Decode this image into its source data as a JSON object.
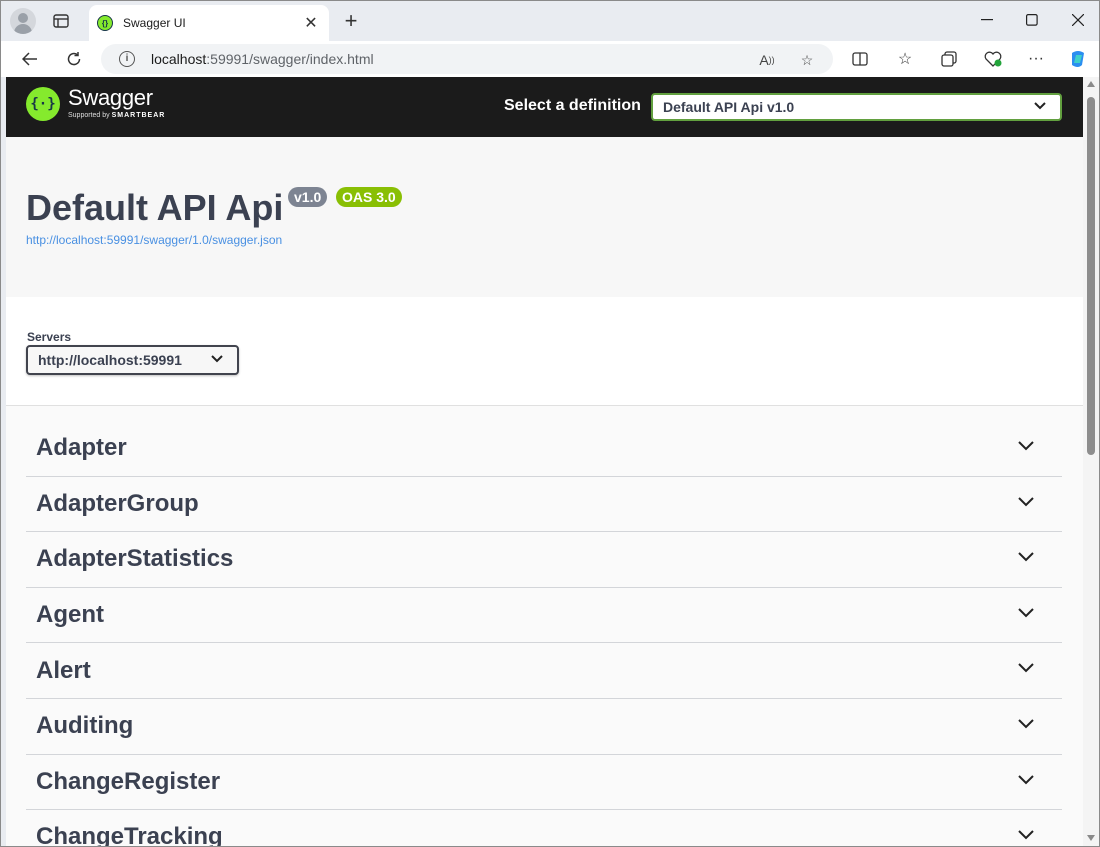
{
  "browser": {
    "tab_title": "Swagger UI",
    "url_host": "localhost",
    "url_rest": ":59991/swagger/index.html"
  },
  "swagger": {
    "logo_text": "Swagger",
    "logo_tagline_prefix": "Supported by",
    "logo_tagline_brand": "SMARTBEAR",
    "select_definition_label": "Select a definition",
    "definition_selected": "Default API Api v1.0",
    "api_title": "Default API Api",
    "version_badge": "v1.0",
    "oas_badge": "OAS 3.0",
    "spec_url": "http://localhost:59991/swagger/1.0/swagger.json",
    "servers_label": "Servers",
    "server_selected": "http://localhost:59991",
    "tags": [
      {
        "name": "Adapter"
      },
      {
        "name": "AdapterGroup"
      },
      {
        "name": "AdapterStatistics"
      },
      {
        "name": "Agent"
      },
      {
        "name": "Alert"
      },
      {
        "name": "Auditing"
      },
      {
        "name": "ChangeRegister"
      },
      {
        "name": "ChangeTracking"
      }
    ]
  },
  "colors": {
    "topbar": "#1b1b1b",
    "swagger_green": "#85ea2d",
    "oas_badge": "#89bf04",
    "version_badge": "#7d8492",
    "link": "#4990e2",
    "text": "#3b4151"
  }
}
